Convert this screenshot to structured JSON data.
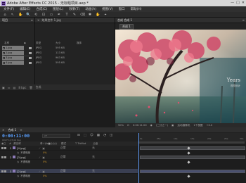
{
  "titlebar": {
    "app_icon": "Ae",
    "title": "Adobe After Effects CC 2015 - 无标题项目.aep *",
    "min": "—",
    "max": "□",
    "close": "✕"
  },
  "menus": [
    "文件(F)",
    "编辑(E)",
    "合成(C)",
    "图层(L)",
    "效果(T)",
    "动画(A)",
    "视图(V)",
    "窗口",
    "帮助(H)"
  ],
  "toolbar_icons": [
    "⌂",
    "↖",
    "✋",
    "🔍",
    "⟲",
    "⊡",
    "▭",
    "✒",
    "T",
    "✎",
    "⌫",
    "✱",
    "✋",
    "⌖"
  ],
  "project_panel": {
    "tab": "项目",
    "menu_icon": "≡"
  },
  "effects_panel": {
    "tab": "效果控件 1.jpg",
    "close": "×"
  },
  "file_list": {
    "headers": [
      "名称",
      "类型",
      "大小",
      "媒体"
    ],
    "rows": [
      {
        "name": "1.jpg",
        "type": "JPEG",
        "size": "595 KB"
      },
      {
        "name": "2.jpg",
        "type": "JPEG",
        "size": "113 KB"
      },
      {
        "name": "3.jpg",
        "type": "JPEG",
        "size": "963 KB"
      },
      {
        "name": "4.jpg",
        "type": "JPEG",
        "size": "595 KB"
      }
    ],
    "bottom_label": "8 bpc",
    "bottom_name": "合成"
  },
  "composition_panel": {
    "tab": "合成 合成 1",
    "sub_tab": "合成 1",
    "menu_icon": "≡"
  },
  "viewer": {
    "overlay_text": "Years",
    "overlay_sub": "视觉设计"
  },
  "viewer_controls": {
    "zoom": "50%",
    "timecode": "0:00:11:00",
    "quality": "(二分之一)",
    "camera": "活动摄像机",
    "views": "1个视图",
    "plus": "+0.0"
  },
  "timeline": {
    "tab": "合成 1",
    "tab2": "渲染队列",
    "current_time": "0:00:11:00",
    "frames": "00275 (25.00 fps)",
    "search_placeholder": "ρ▾",
    "col_headers": [
      "#",
      "源名称",
      "单☆\\fx■◎◎◎",
      "模式",
      "T  TrkMat",
      "父级"
    ],
    "layers": [
      {
        "num": "1",
        "name": "[4.jpg]",
        "mode": "正常",
        "parent": "无",
        "label_color": "#8d7bb8"
      },
      {
        "num": "2",
        "name": "[3.jpg]",
        "mode": "正常",
        "parent": "无",
        "label_color": "#8d7bb8"
      },
      {
        "num": "3",
        "name": "[2.jpg]",
        "mode": "正常",
        "parent": "无",
        "label_color": "#8d7bb8"
      }
    ],
    "sub_props": [
      {
        "label": "不透明度",
        "value": "0%"
      },
      {
        "label": "不透明度",
        "value": "0%"
      },
      {
        "label": "不透明度",
        "value": "0%"
      }
    ],
    "ruler_ticks": [
      "0s",
      "05s",
      "10s",
      "15s",
      "20s",
      "25s",
      "30s"
    ]
  }
}
